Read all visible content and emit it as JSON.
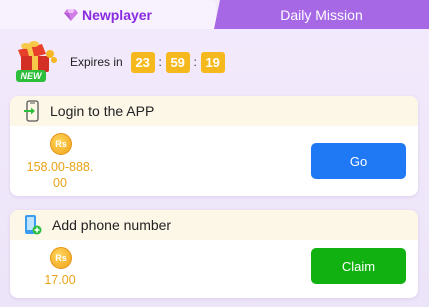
{
  "tabs": [
    {
      "label": "Newplayer",
      "active": true
    },
    {
      "label": "Daily Mission",
      "active": false
    }
  ],
  "expiry": {
    "badge_text": "NEW",
    "label": "Expires in",
    "hours": "23",
    "minutes": "59",
    "seconds": "19",
    "separator": ":"
  },
  "tasks": [
    {
      "title": "Login to the APP",
      "icon": "phone-login-icon",
      "currency": "Rs",
      "reward_line1": "158.00-888.",
      "reward_line2": "00",
      "button_label": "Go",
      "button_color": "#1f79f5"
    },
    {
      "title": "Add phone number",
      "icon": "phone-add-icon",
      "currency": "Rs",
      "reward_line1": "17.00",
      "button_label": "Claim",
      "button_color": "#11b111"
    }
  ],
  "colors": {
    "accent_purple": "#8a2be2",
    "tab_inactive_bg": "#a768e6",
    "timer_bg": "#f6b91d",
    "reward_gold": "#e8a316"
  }
}
